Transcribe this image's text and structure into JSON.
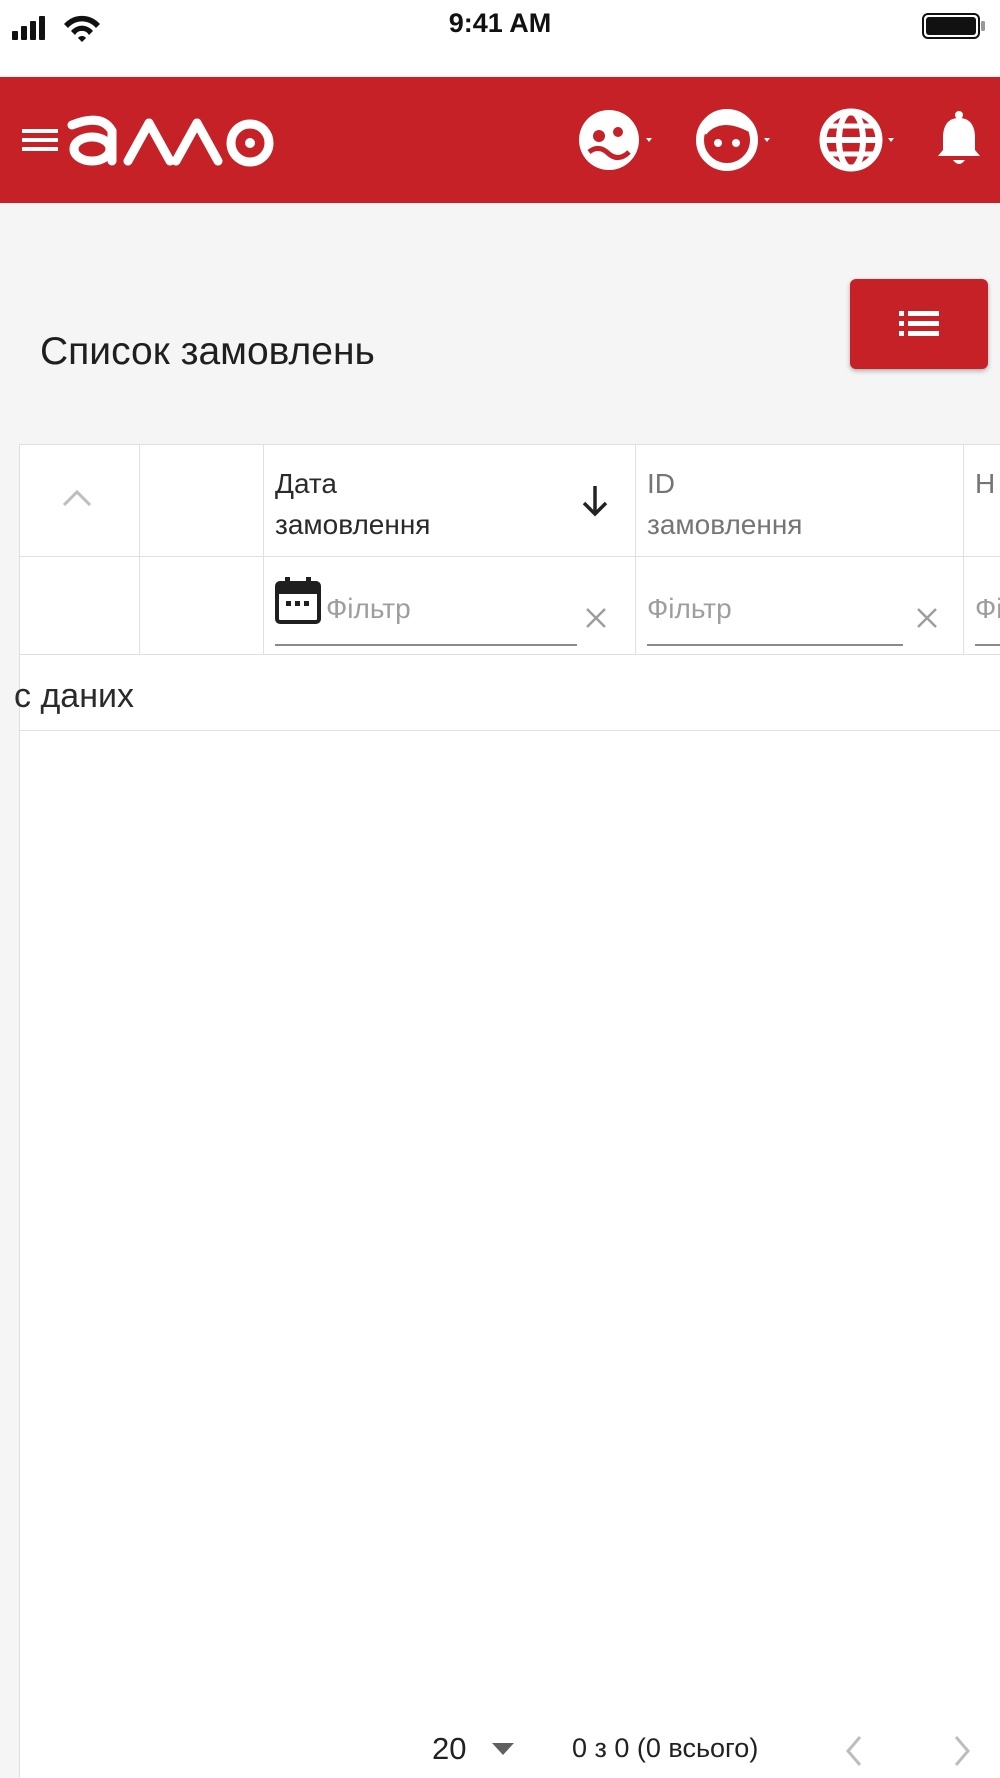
{
  "status_bar": {
    "time": "9:41 AM",
    "signal_icon": "signal-icon",
    "wifi_icon": "wifi-icon",
    "battery_icon": "battery-icon"
  },
  "app_bar": {
    "brand": "алло",
    "background_color": "#c62127",
    "icons": [
      "menu-icon",
      "group-face-icon",
      "face-icon",
      "globe-icon",
      "bell-icon"
    ]
  },
  "page": {
    "title": "Список замовлень",
    "columns_button_icon": "list-icon"
  },
  "grid": {
    "columns": [
      {
        "title_line1": "Дата",
        "title_line2": "замовлення",
        "sort": "descending"
      },
      {
        "title_line1": "ID",
        "title_line2": "замовлення"
      },
      {
        "title_line1": "Н"
      }
    ],
    "filters": [
      {
        "placeholder": "Фільтр"
      },
      {
        "placeholder": "Фільтр"
      },
      {
        "placeholder": "Фі"
      }
    ],
    "no_data_text": "с даних"
  },
  "pager": {
    "page_size": "20",
    "range_text": "0 з 0 (0 всього)"
  }
}
